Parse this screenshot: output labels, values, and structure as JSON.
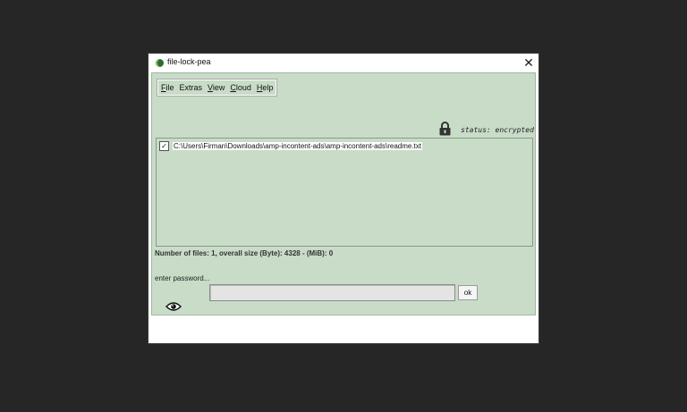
{
  "window": {
    "title": "file-lock-pea",
    "close_glyph": "✕"
  },
  "menu": {
    "items": [
      {
        "mnemonic": "F",
        "rest": "ile"
      },
      {
        "mnemonic": "",
        "rest": "Extras"
      },
      {
        "mnemonic": "V",
        "rest": "iew"
      },
      {
        "mnemonic": "C",
        "rest": "loud"
      },
      {
        "mnemonic": "H",
        "rest": "elp"
      }
    ]
  },
  "status": {
    "text": "status: encrypted",
    "icon": "padlock-icon"
  },
  "files": [
    {
      "checked": true,
      "check_glyph": "✓",
      "path": "C:\\Users\\Firman\\Downloads\\amp-incontent-ads\\amp-incontent-ads\\readme.txt"
    }
  ],
  "file_summary": "Number of files: 1, overall size (Byte): 4328 - (MiB): 0",
  "password": {
    "label": "enter password...",
    "value": "",
    "ok_label": "ok",
    "eye_icon": "eye-icon"
  },
  "colors": {
    "panel_bg": "#c8dcc8",
    "screen_bg": "#262626"
  }
}
